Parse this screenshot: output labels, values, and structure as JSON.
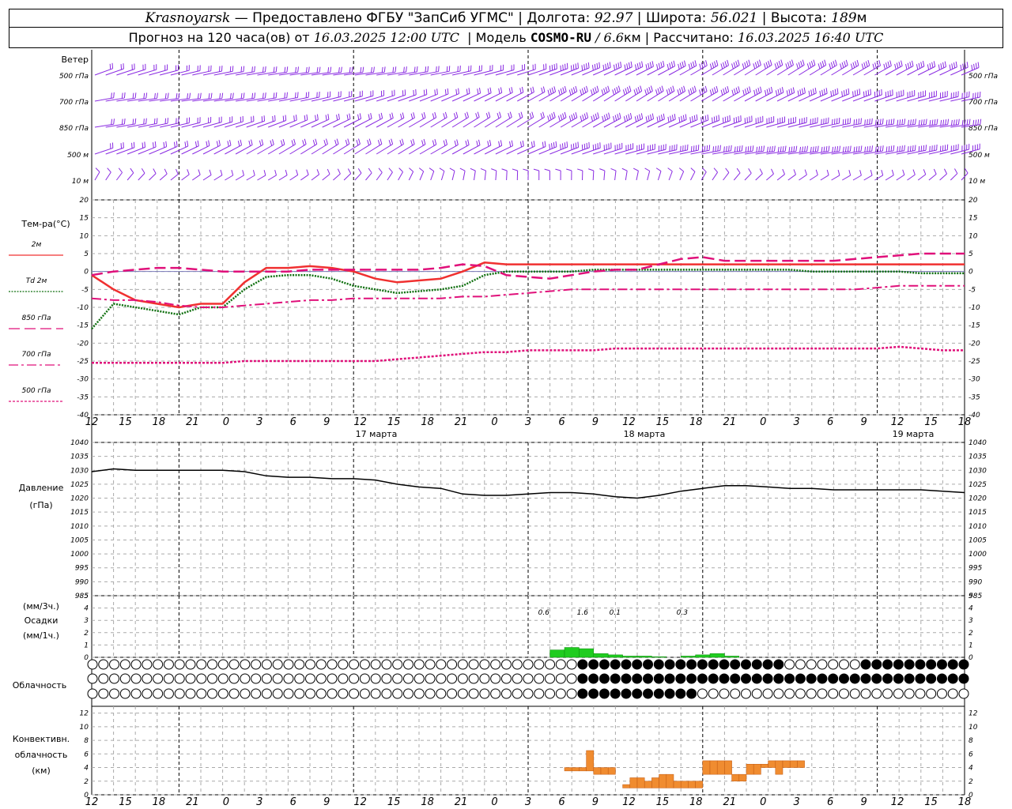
{
  "header": {
    "city": "Krasnoyarsk",
    "dash": "—",
    "provider": "Предоставлено ФГБУ \"ЗапСиб УГМС\"",
    "lon_label": "Долгота:",
    "lon_value": "92.97",
    "lat_label": "Широта:",
    "lat_value": "56.021",
    "alt_label": "Высота:",
    "alt_value": "189",
    "alt_unit": "м",
    "forecast_text": "Прогноз на 120 часа(ов) от",
    "forecast_start": "16.03.2025 12:00 UTC",
    "model_label": "Модель",
    "model_name": "COSMO-RU",
    "model_res": "/ 6.6",
    "model_res_unit": "км",
    "calc_label": "Рассчитано:",
    "calc_time": "16.03.2025 16:40 UTC"
  },
  "wind_panel": {
    "title": "Ветер",
    "levels": [
      "500 гПа",
      "700 гПа",
      "850 гПа",
      "500 м",
      "10 м"
    ]
  },
  "temp_panel": {
    "title": "Тем-ра(°C)",
    "legend": [
      {
        "label": "2м",
        "color": "#f03030",
        "style": "solid"
      },
      {
        "label": "Td 2м",
        "color": "#107010",
        "style": "dotted"
      },
      {
        "label": "850 гПа",
        "color": "#e0107a",
        "style": "dash"
      },
      {
        "label": "700 гПа",
        "color": "#e0107a",
        "style": "dashdot"
      },
      {
        "label": "500 гПа",
        "color": "#e0107a",
        "style": "dot"
      }
    ],
    "ticks": [
      "20",
      "15",
      "10",
      "5",
      "0",
      "-5",
      "-10",
      "-15",
      "-20",
      "-25",
      "-30",
      "-35",
      "-40"
    ]
  },
  "time_axis": {
    "hours": [
      "12",
      "15",
      "18",
      "21",
      "0",
      "3",
      "6",
      "9",
      "12",
      "15",
      "18",
      "21",
      "0",
      "3",
      "6",
      "9",
      "12",
      "15",
      "18",
      "21",
      "0",
      "3",
      "6",
      "9",
      "12",
      "15",
      "18"
    ],
    "dates": [
      "17 марта",
      "18 марта",
      "19 марта"
    ]
  },
  "pressure_panel": {
    "title": "Давление",
    "unit": "(гПа)",
    "ticks": [
      "1040",
      "1035",
      "1030",
      "1025",
      "1020",
      "1015",
      "1010",
      "1005",
      "1000",
      "995",
      "990",
      "985"
    ]
  },
  "precip_panel": {
    "unit_3h": "(мм/3ч.)",
    "title": "Осадки",
    "unit_1h": "(мм/1ч.)",
    "ticks": [
      "5",
      "4",
      "3",
      "2",
      "1",
      "0"
    ],
    "totals": [
      "0.6",
      "1.6",
      "0.1",
      "0.3"
    ]
  },
  "cloud_panel": {
    "title": "Облачность"
  },
  "conv_panel": {
    "title_1": "Конвективн.",
    "title_2": "облачность",
    "unit": "(км)",
    "ticks": [
      "12",
      "10",
      "8",
      "6",
      "4",
      "2",
      "0"
    ]
  },
  "chart_data": [
    {
      "type": "line",
      "title": "Тем-ра(°C)",
      "x_hours_from_start": [
        0,
        3,
        6,
        9,
        12,
        15,
        18,
        21,
        24,
        27,
        30,
        33,
        36,
        39,
        42,
        45,
        48,
        51,
        54,
        57,
        60,
        63,
        66,
        69,
        72,
        75,
        78,
        81,
        84,
        87,
        90,
        93,
        96,
        99,
        102,
        105,
        108,
        111,
        114,
        117,
        120
      ],
      "ylim": [
        -40,
        20
      ],
      "series": [
        {
          "name": "2м",
          "color": "#f03030",
          "values": [
            -1,
            -5,
            -8,
            -9,
            -10,
            -9,
            -9,
            -3,
            1,
            1,
            1.5,
            1,
            0,
            -2,
            -3,
            -2.5,
            -2,
            0,
            2.5,
            2,
            2,
            2,
            2,
            2,
            2,
            2,
            2,
            2,
            2,
            2,
            2,
            2,
            2,
            2,
            2,
            2,
            2,
            2,
            2,
            2,
            2
          ]
        },
        {
          "name": "Td 2м",
          "color": "#107010",
          "values": [
            -16,
            -9,
            -10,
            -11,
            -12,
            -10,
            -10,
            -5,
            -1.5,
            -1,
            -1,
            -2,
            -4,
            -5,
            -6,
            -5.5,
            -5,
            -4,
            -1,
            0,
            0,
            0,
            0,
            0.5,
            0.5,
            0.5,
            0.5,
            0.5,
            0.5,
            0.5,
            0.5,
            0.5,
            0.5,
            0,
            0,
            0,
            0,
            0,
            -0.5,
            -0.5,
            -0.5
          ]
        },
        {
          "name": "850 гПа",
          "color": "#e0107a",
          "values": [
            -1,
            0,
            0.5,
            1,
            1,
            0.5,
            0,
            0,
            0,
            0,
            0.5,
            0.5,
            0.5,
            0.5,
            0.5,
            0.5,
            1,
            2,
            1.5,
            -1,
            -1.5,
            -2,
            -1,
            0,
            0.5,
            0.5,
            2,
            3.5,
            4,
            3,
            3,
            3,
            3,
            3,
            3,
            3.5,
            4,
            4.5,
            5,
            5,
            5
          ]
        },
        {
          "name": "700 гПа",
          "color": "#e0107a",
          "values": [
            -7.5,
            -8,
            -8,
            -8.5,
            -9.5,
            -10,
            -10,
            -9.5,
            -9,
            -8.5,
            -8,
            -8,
            -7.5,
            -7.5,
            -7.5,
            -7.5,
            -7.5,
            -7,
            -7,
            -6.5,
            -6,
            -5.5,
            -5,
            -5,
            -5,
            -5,
            -5,
            -5,
            -5,
            -5,
            -5,
            -5,
            -5,
            -5,
            -5,
            -5,
            -4.5,
            -4,
            -4,
            -4,
            -4
          ]
        },
        {
          "name": "500 гПа",
          "color": "#e0107a",
          "values": [
            -25.5,
            -25.5,
            -25.5,
            -25.5,
            -25.5,
            -25.5,
            -25.5,
            -25,
            -25,
            -25,
            -25,
            -25,
            -25,
            -25,
            -24.5,
            -24,
            -23.5,
            -23,
            -22.5,
            -22.5,
            -22,
            -22,
            -22,
            -22,
            -21.5,
            -21.5,
            -21.5,
            -21.5,
            -21.5,
            -21.5,
            -21.5,
            -21.5,
            -21.5,
            -21.5,
            -21.5,
            -21.5,
            -21.5,
            -21,
            -21.5,
            -22,
            -22
          ]
        }
      ]
    },
    {
      "type": "line",
      "title": "Давление",
      "x_hours_from_start": [
        0,
        3,
        6,
        9,
        12,
        15,
        18,
        21,
        24,
        27,
        30,
        33,
        36,
        39,
        42,
        45,
        48,
        51,
        54,
        57,
        60,
        63,
        66,
        69,
        72,
        75,
        78,
        81,
        84,
        87,
        90,
        93,
        96,
        99,
        102,
        105,
        108,
        111,
        114,
        117,
        120
      ],
      "ylim": [
        985,
        1040
      ],
      "series": [
        {
          "name": "Давление",
          "color": "#000000",
          "values": [
            1029.5,
            1030.5,
            1030,
            1030,
            1030,
            1030,
            1030,
            1029.5,
            1028,
            1027.5,
            1027.5,
            1027,
            1027,
            1026.5,
            1025,
            1024,
            1023.5,
            1021.5,
            1021,
            1021,
            1021.5,
            1022,
            1022,
            1021.5,
            1020.5,
            1020,
            1021,
            1022.5,
            1023.5,
            1024.5,
            1024.5,
            1024,
            1023.5,
            1023.5,
            1023,
            1023,
            1023,
            1023,
            1023,
            1022.5,
            1022
          ]
        }
      ]
    },
    {
      "type": "bar",
      "title": "Осадки",
      "x_hours_from_start": [
        63,
        65,
        67,
        69,
        71,
        73,
        75,
        77,
        79,
        81,
        83,
        85,
        87
      ],
      "ylim": [
        0,
        5
      ],
      "series": [
        {
          "name": "мм/1ч.",
          "color": "#20cc20",
          "values": [
            0.6,
            0.8,
            0.7,
            0.3,
            0.2,
            0.1,
            0.1,
            0.05,
            0,
            0.1,
            0.2,
            0.3,
            0.1
          ]
        }
      ]
    },
    {
      "type": "bar",
      "title": "Конвективн. облачность",
      "x_hours_from_start": [
        65,
        66,
        67,
        68,
        69,
        70,
        71,
        73,
        74,
        75,
        76,
        77,
        78,
        79,
        80,
        81,
        82,
        83,
        84,
        85,
        86,
        87,
        88,
        89,
        90,
        91,
        92,
        93,
        94,
        95,
        96,
        97
      ],
      "ylim": [
        0,
        13
      ],
      "series": [
        {
          "name": "облачность",
          "color": "#f08c30",
          "bottom": [
            3.5,
            3.5,
            3.5,
            3.5,
            3,
            3,
            3,
            1,
            1,
            1,
            1,
            1,
            1,
            1,
            1,
            1,
            1,
            1,
            3,
            3,
            3,
            3,
            2,
            2,
            3,
            3,
            4,
            4,
            3,
            4,
            4,
            4
          ],
          "top": [
            4,
            4,
            4,
            6.5,
            4,
            4,
            4,
            1.5,
            2.5,
            2.5,
            2,
            2.5,
            3,
            3,
            2,
            2,
            2,
            2,
            5,
            5,
            5,
            5,
            3,
            3,
            4.5,
            4.5,
            4.5,
            5,
            5,
            5,
            5,
            5
          ]
        }
      ]
    }
  ]
}
